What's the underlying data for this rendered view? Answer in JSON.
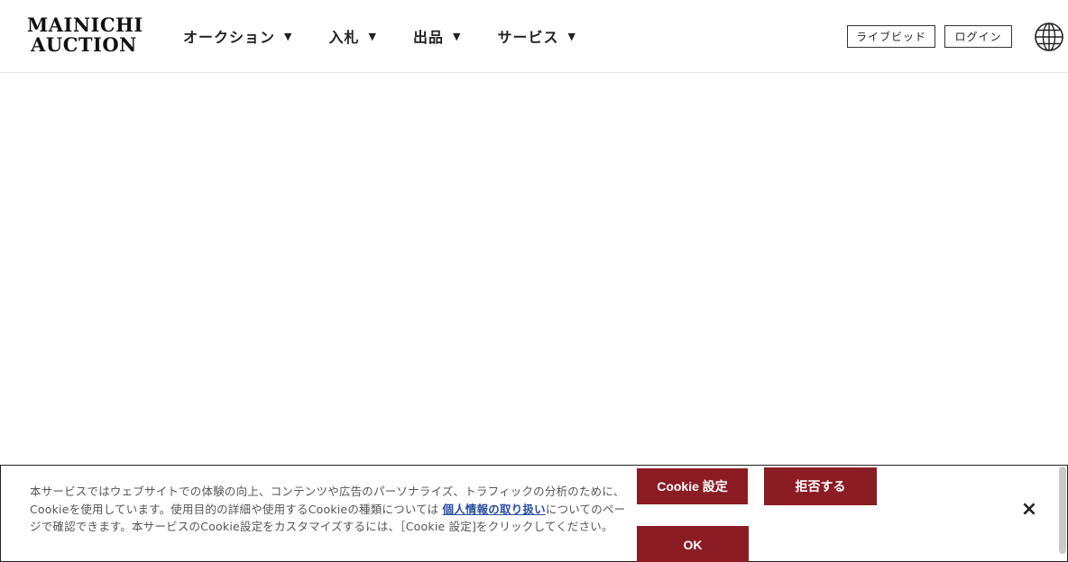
{
  "header": {
    "logo_line1": "MAINICHI",
    "logo_line2": "AUCTION",
    "nav": [
      {
        "label": "オークション",
        "caret": "▼"
      },
      {
        "label": "入札",
        "caret": "▼"
      },
      {
        "label": "出品",
        "caret": "▼"
      },
      {
        "label": "サービス",
        "caret": "▼"
      }
    ],
    "livebid_label": "ライブビッド",
    "login_label": "ログイン",
    "language_icon": "globe-icon"
  },
  "cookie_banner": {
    "text_before": "本サービスではウェブサイトでの体験の向上、コンテンツや広告のパーソナライズ、トラフィックの分析のために、Cookieを使用しています。使用目的の詳細や使用するCookieの種類については",
    "link": "個人情報の取り扱い",
    "text_after": "についてのページで確認できます。本サービスのCookie設定をカスタマイズするには、［Cookie 設定]をクリックしてください。",
    "settings_label": "Cookie 設定",
    "reject_label": "拒否する",
    "ok_label": "OK",
    "close_label": "×"
  },
  "colors": {
    "accent": "#8b1c24",
    "link": "#2a4ea1"
  }
}
